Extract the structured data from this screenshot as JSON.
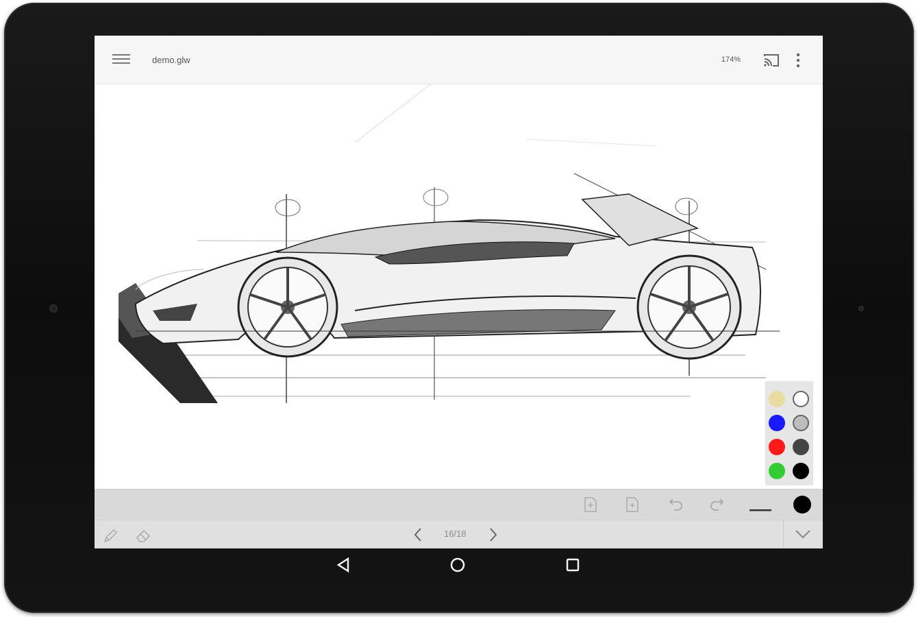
{
  "topbar": {
    "file_name": "demo.glw",
    "zoom_level": "174%",
    "menu_icon": "hamburger-menu-icon",
    "cast_icon": "cast-icon",
    "more_icon": "more-vert-icon"
  },
  "palette": {
    "colors": [
      "#e8dca0",
      "#ffffff",
      "#1a1aff",
      "#bdbdbd",
      "#ff1a1a",
      "#444444",
      "#33cc33",
      "#000000"
    ]
  },
  "toolbar": {
    "add_page_before_icon": "add-page-before-icon",
    "add_page_after_icon": "add-page-after-icon",
    "undo_icon": "undo-icon",
    "redo_icon": "redo-icon",
    "stroke_width_icon": "stroke-width-icon",
    "current_color": "#000000"
  },
  "bottom": {
    "pen_icon": "pencil-icon",
    "eraser_icon": "eraser-icon",
    "prev_icon": "chevron-left-icon",
    "page_indicator": "16/18",
    "next_icon": "chevron-right-icon",
    "collapse_icon": "chevron-down-icon"
  },
  "android_nav": {
    "back_icon": "back-triangle-icon",
    "home_icon": "home-circle-icon",
    "recents_icon": "recents-square-icon"
  }
}
